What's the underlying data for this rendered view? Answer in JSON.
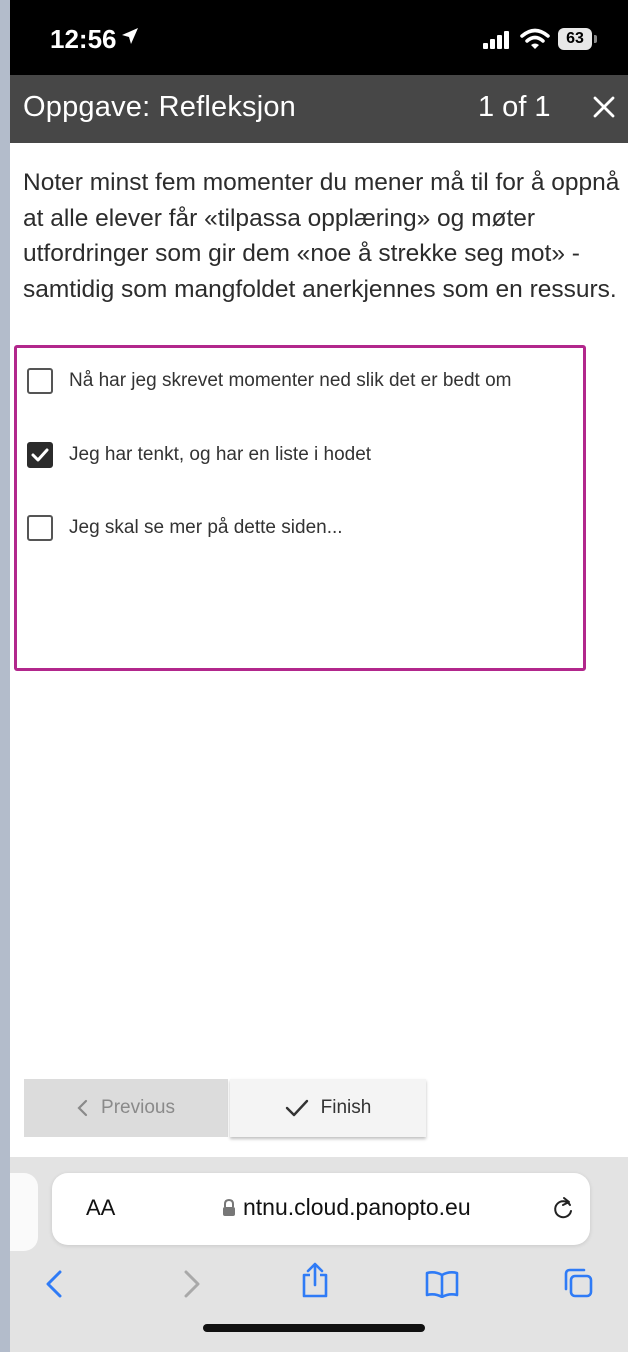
{
  "status_bar": {
    "time": "12:56",
    "battery": "63"
  },
  "header": {
    "title": "Oppgave: Refleksjon",
    "counter": "1 of 1"
  },
  "question": "Noter minst fem momenter du mener må til for å oppnå at alle elever får «tilpassa opplæring» og møter utfordringer som gir dem «noe å strekke seg mot» - samtidig som mangfoldet anerkjennes som en ressurs.",
  "options": [
    {
      "label": "Nå har jeg skrevet momenter ned slik det er bedt om",
      "checked": false
    },
    {
      "label": "Jeg har tenkt, og har en liste i hodet",
      "checked": true
    },
    {
      "label": "Jeg skal se mer på dette siden...",
      "checked": false
    }
  ],
  "nav": {
    "previous_label": "Previous",
    "finish_label": "Finish"
  },
  "browser": {
    "text_size_label": "AA",
    "url": "ntnu.cloud.panopto.eu"
  },
  "colors": {
    "header_bg": "#474747",
    "highlight_border": "#b2278c",
    "safari_blue": "#2f7bf6"
  }
}
